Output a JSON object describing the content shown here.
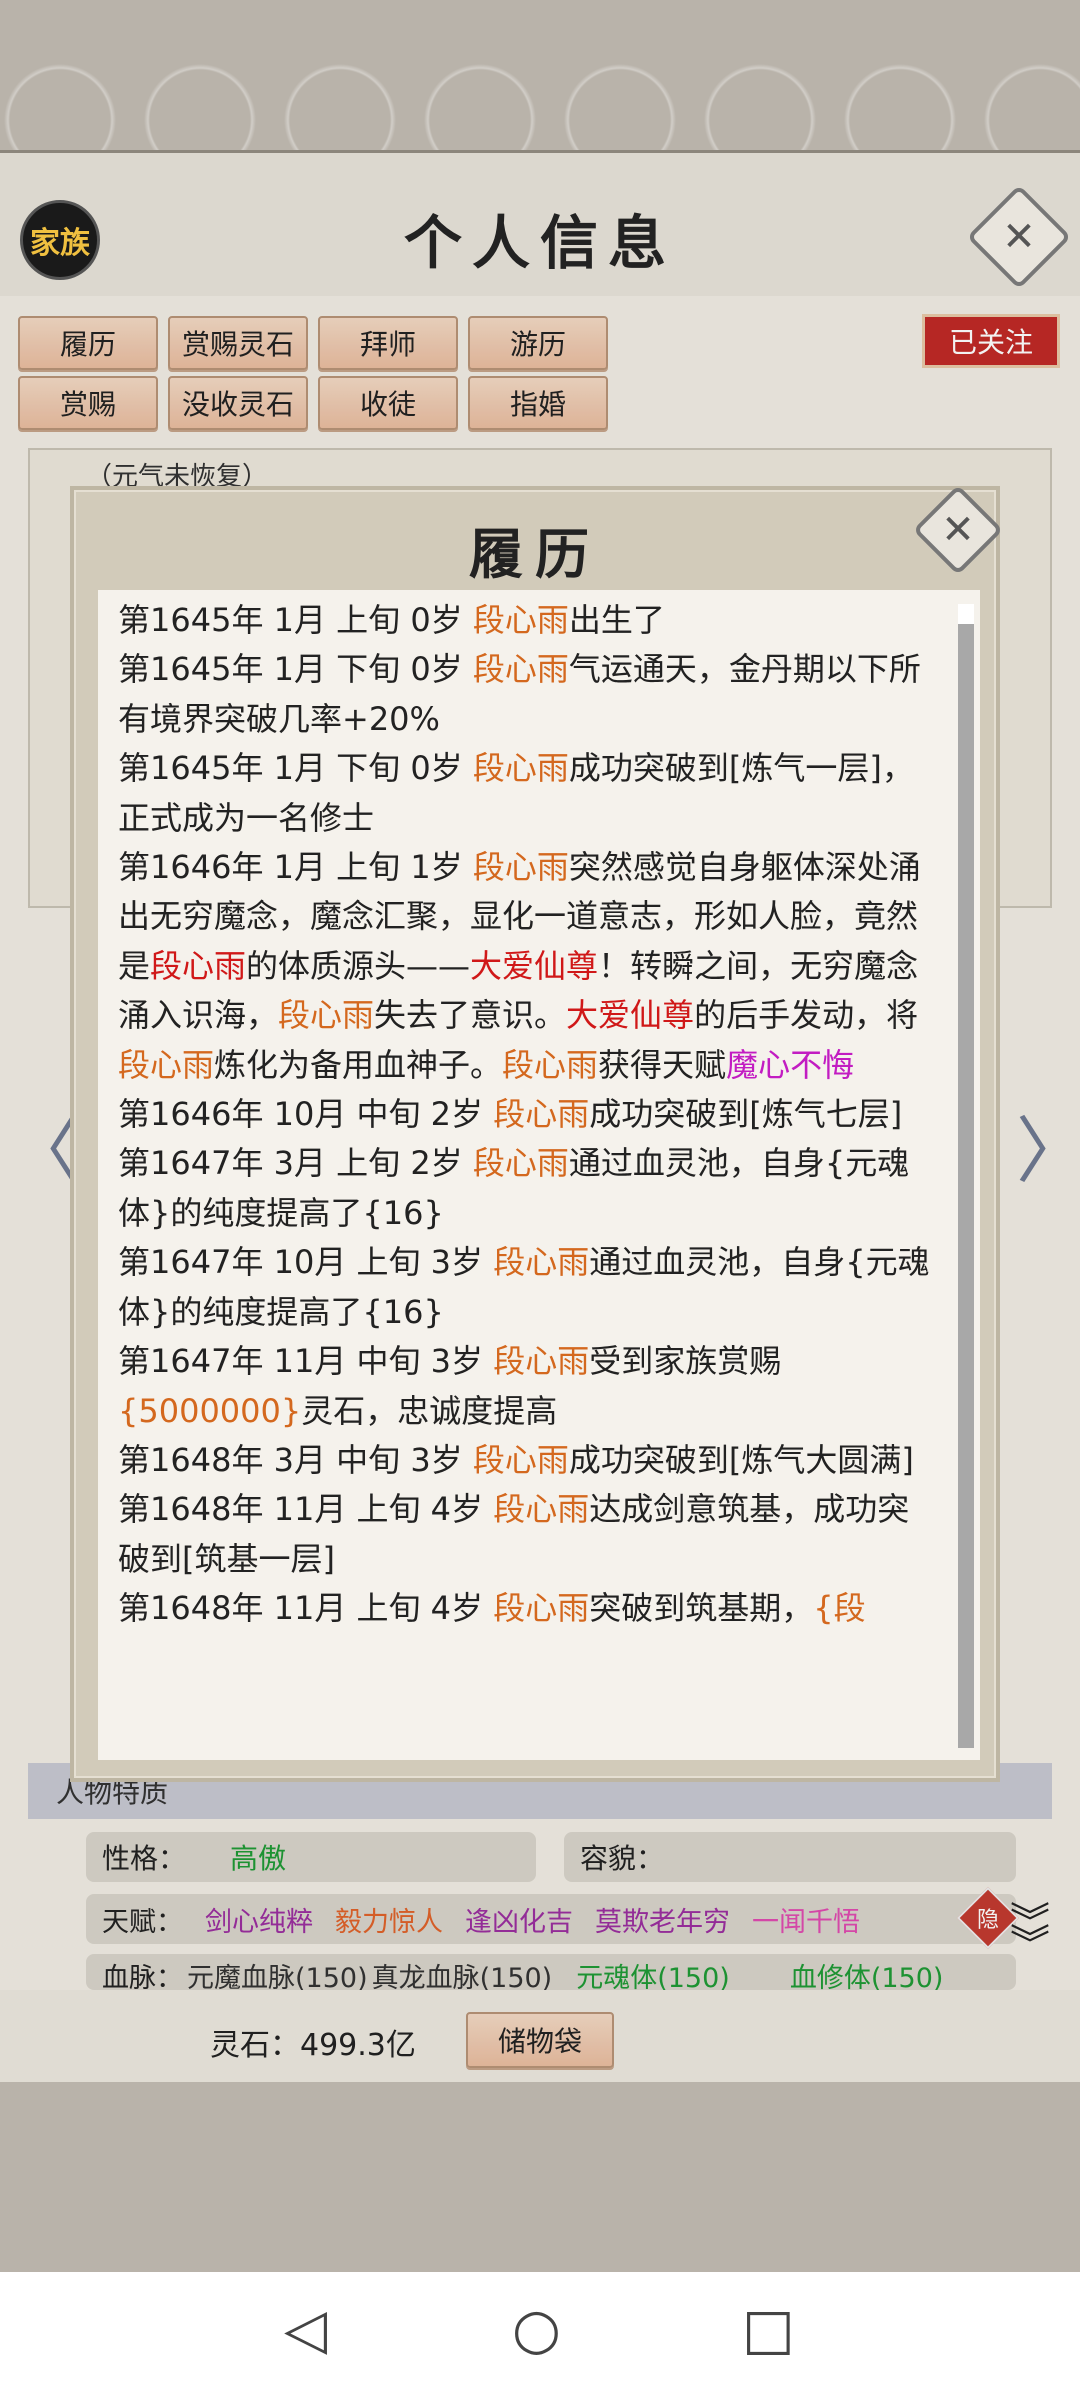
{
  "header": {
    "clan_label": "家族",
    "title": "个人信息",
    "close_glyph": "✕"
  },
  "actions": {
    "row1": [
      "履历",
      "赏赐灵石",
      "拜师",
      "游历"
    ],
    "row2": [
      "赏赐",
      "没收灵石",
      "收徒",
      "指婚"
    ],
    "follow": "已关注"
  },
  "background_panel": {
    "qi_status": "（元气未恢复）"
  },
  "modal": {
    "title": "履历",
    "close_glyph": "✕",
    "entries": [
      [
        {
          "t": "第1645年 1月 上旬  0岁  "
        },
        {
          "t": "段心雨",
          "c": "o"
        },
        {
          "t": "出生了"
        }
      ],
      [
        {
          "t": "第1645年 1月 下旬 0岁  "
        },
        {
          "t": "段心雨",
          "c": "o"
        },
        {
          "t": "气运通天，金丹期以下所有境界突破几率+20%"
        }
      ],
      [
        {
          "t": "第1645年  1月  下旬   0岁    "
        },
        {
          "t": "段心雨",
          "c": "o"
        },
        {
          "t": "成功突破到[炼气一层]，正式成为一名修士"
        }
      ],
      [
        {
          "t": "第1646年 1月 上旬 1岁  "
        },
        {
          "t": "段心雨",
          "c": "o"
        },
        {
          "t": "突然感觉自身躯体深处涌出无穷魔念，魔念汇聚，显化一道意志，形如人脸，竟然是"
        },
        {
          "t": "段心雨",
          "c": "r"
        },
        {
          "t": "的体质源头——"
        },
        {
          "t": "大爱仙尊",
          "c": "r"
        },
        {
          "t": "！转瞬之间，无穷魔念涌入识海，"
        },
        {
          "t": "段心雨",
          "c": "o"
        },
        {
          "t": "失去了意识。"
        },
        {
          "t": "大爱仙尊",
          "c": "r"
        },
        {
          "t": "的后手发动，将"
        },
        {
          "t": "段心雨",
          "c": "o"
        },
        {
          "t": "炼化为备用血神子。"
        },
        {
          "t": "段心雨",
          "c": "o"
        },
        {
          "t": "获得天赋"
        },
        {
          "t": "魔心不悔",
          "c": "m"
        }
      ],
      [
        {
          "t": "第1646年 10月 中旬  2岁  "
        },
        {
          "t": "段心雨",
          "c": "o"
        },
        {
          "t": "成功突破到[炼气七层]"
        }
      ],
      [
        {
          "t": "第1647年 3月 上旬 2岁  "
        },
        {
          "t": "段心雨",
          "c": "o"
        },
        {
          "t": "通过血灵池，自身{元魂体}的纯度提高了{16}"
        }
      ],
      [
        {
          "t": "第1647年 10月 上旬  3岁  "
        },
        {
          "t": "段心雨",
          "c": "o"
        },
        {
          "t": "通过血灵池，自身{元魂体}的纯度提高了{16}"
        }
      ],
      [
        {
          "t": "第1647年   11月   中旬     3岁      "
        },
        {
          "t": "段心雨",
          "c": "o"
        },
        {
          "t": "受到家族赏赐"
        },
        {
          "t": "{5000000}",
          "c": "o"
        },
        {
          "t": "灵石，忠诚度提高"
        }
      ],
      [
        {
          "t": "第1648年 3月 中旬  3岁  "
        },
        {
          "t": "段心雨",
          "c": "o"
        },
        {
          "t": "成功突破到[炼气大圆满]"
        }
      ],
      [
        {
          "t": "第1648年 11月 上旬  4岁  "
        },
        {
          "t": "段心雨",
          "c": "o"
        },
        {
          "t": "达成剑意筑基，成功突破到[筑基一层]"
        }
      ],
      [
        {
          "t": "第1648年  11月  上旬   4岁    "
        },
        {
          "t": "段心雨",
          "c": "o"
        },
        {
          "t": "突破到筑基期，"
        },
        {
          "t": "{段",
          "c": "o"
        }
      ]
    ]
  },
  "traits": {
    "section_title": "人物特质",
    "personality_label": "性格：",
    "personality_value": "高傲",
    "looks_label": "容貌：",
    "talent_label": "天赋：",
    "talents": [
      {
        "name": "剑心纯粹",
        "color": "#9b2fa0"
      },
      {
        "name": "毅力惊人",
        "color": "#e0622a"
      },
      {
        "name": "逢凶化吉",
        "color": "#9b2fa0"
      },
      {
        "name": "莫欺老年穷",
        "color": "#9b2fa0"
      },
      {
        "name": "一闻千悟",
        "color": "#e04bb0"
      }
    ],
    "hidden_badge": "隐",
    "bloodline_label": "血脉：",
    "bloodlines": [
      {
        "name": "元魔血脉(150)",
        "color": "#333333"
      },
      {
        "name": "真龙血脉(150)",
        "color": "#333333"
      },
      {
        "name": "元魂体(150)",
        "color": "#1f9a35"
      },
      {
        "name": "血修体(150)",
        "color": "#1f9a35"
      }
    ]
  },
  "footer": {
    "spirit_stone": "灵石：499.3亿",
    "storage_bag": "储物袋"
  },
  "colors": {
    "name_orange": "#d4681e",
    "highlight_red": "#d01818",
    "talent_magenta": "#c21cc2",
    "follow_red": "#c02a26"
  }
}
